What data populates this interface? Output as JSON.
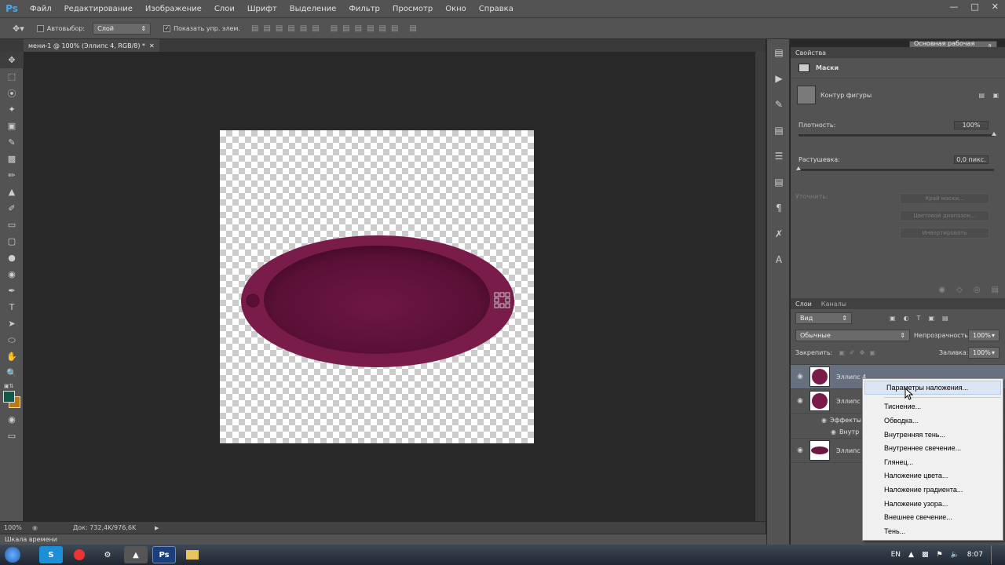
{
  "app": {
    "logo": "Ps"
  },
  "menu": [
    "Файл",
    "Редактирование",
    "Изображение",
    "Слои",
    "Шрифт",
    "Выделение",
    "Фильтр",
    "Просмотр",
    "Окно",
    "Справка"
  ],
  "options": {
    "autoselect_label": "Автовыбор:",
    "autoselect_value": "Слой",
    "show_controls_label": "Показать упр. элем.",
    "workspace": "Основная рабочая среда"
  },
  "document": {
    "tab_title": "мени-1 @ 100% (Эллипс 4, RGB/8) *"
  },
  "status": {
    "zoom": "100%",
    "doc_size": "Док: 732,4K/976,6K"
  },
  "timeline": {
    "label": "Шкала времени"
  },
  "properties": {
    "title": "Свойства",
    "section": "Маски",
    "shape_mask": "Контур фигуры",
    "density_label": "Плотность:",
    "density_value": "100%",
    "density_level": 1.0,
    "feather_label": "Растушевка:",
    "feather_value": "0,0 пикс.",
    "feather_level": 0.0,
    "refine_label": "Уточнить:",
    "mask_edge_btn": "Край маски...",
    "color_range_btn": "Цветовой диапазон...",
    "invert_btn": "Инвертировать"
  },
  "layers_panel": {
    "tab_layers": "Слои",
    "tab_channels": "Каналы",
    "filter_kind": "Вид",
    "blend_mode": "Обычные",
    "opacity_label": "Непрозрачность:",
    "opacity_value": "100%",
    "lock_label": "Закрепить:",
    "fill_label": "Заливка:",
    "fill_value": "100%",
    "layers": [
      {
        "name": "Эллипс 4"
      },
      {
        "name": "Эллипс"
      },
      {
        "name": "Эллипс"
      }
    ],
    "effects_label": "Эффекты",
    "effect_inner": "Внутр"
  },
  "context_menu": [
    "Параметры наложения...",
    "Тиснение...",
    "Обводка...",
    "Внутренняя тень...",
    "Внутреннее свечение...",
    "Глянец...",
    "Наложение цвета...",
    "Наложение градиента...",
    "Наложение узора...",
    "Внешнее свечение...",
    "Тень..."
  ],
  "taskbar": {
    "language": "EN",
    "time": "8:07"
  },
  "colors": {
    "ellipse_outer": "#7a1c4a",
    "ellipse_inner": "#5e1138",
    "foreground": "#0f5a4a",
    "background": "#b87a10"
  }
}
